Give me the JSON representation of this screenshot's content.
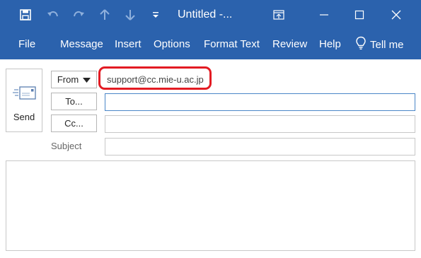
{
  "titlebar": {
    "title": "Untitled  -...",
    "icons": [
      "save-icon",
      "undo-icon",
      "redo-icon",
      "up-arrow-icon",
      "down-arrow-icon",
      "customize-qat-icon"
    ],
    "window_controls": [
      "ribbon-display-icon",
      "minimize-icon",
      "maximize-icon",
      "close-icon"
    ]
  },
  "menu": {
    "items": [
      "File",
      "Message",
      "Insert",
      "Options",
      "Format Text",
      "Review",
      "Help"
    ],
    "tell_me": "Tell me",
    "tell_me_icon": "lightbulb-icon"
  },
  "compose": {
    "send_label": "Send",
    "send_icon": "envelope-send-icon",
    "from_label": "From",
    "from_value": "support@cc.mie-u.ac.jp",
    "to_label": "To...",
    "cc_label": "Cc...",
    "subject_label": "Subject",
    "to_value": "",
    "cc_value": "",
    "subject_value": "",
    "body_text": ""
  },
  "colors": {
    "titlebar": "#2b62ad",
    "highlight": "#e31b23",
    "focus_border": "#4a86c7"
  }
}
